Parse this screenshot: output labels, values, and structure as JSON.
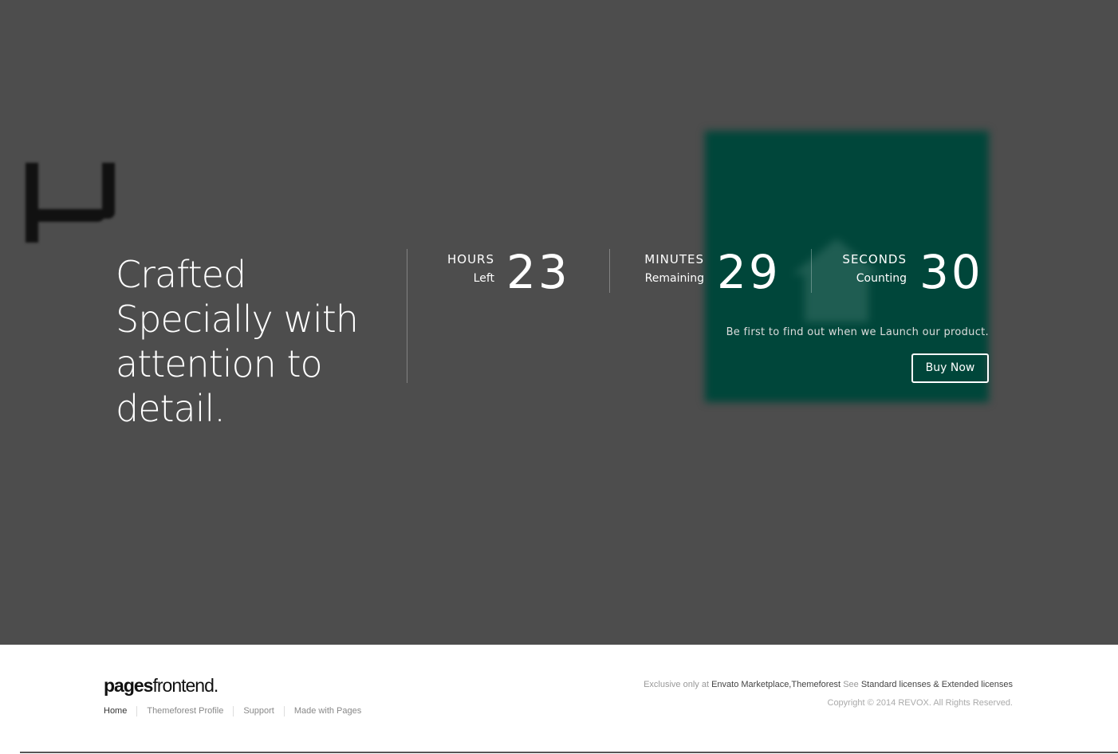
{
  "hero": {
    "headline": "Crafted Specially with attention to detail.",
    "countdown": [
      {
        "label": "HOURS",
        "sub": "Left",
        "value": "23"
      },
      {
        "label": "MINUTES",
        "sub": "Remaining",
        "value": "29"
      },
      {
        "label": "SECONDS",
        "sub": "Counting",
        "value": "30"
      }
    ],
    "launch_text": "Be first to find out when we Launch our product.",
    "buy_button": "Buy Now"
  },
  "footer": {
    "brand_bold": "pages",
    "brand_light": "frontend.",
    "nav": [
      "Home",
      "Themeforest Profile",
      "Support",
      "Made with Pages"
    ],
    "exclusive_prefix": "Exclusive only at",
    "exclusive_link": "Envato Marketplace,Themeforest",
    "see_text": "See",
    "licenses_link": "Standard licenses & Extended licenses",
    "copyright": "Copyright © 2014 REVOX. All Rights Reserved."
  },
  "colors": {
    "hero_bg": "#4d4d4d",
    "accent_green": "#00463a",
    "footer_bg": "#ffffff"
  }
}
